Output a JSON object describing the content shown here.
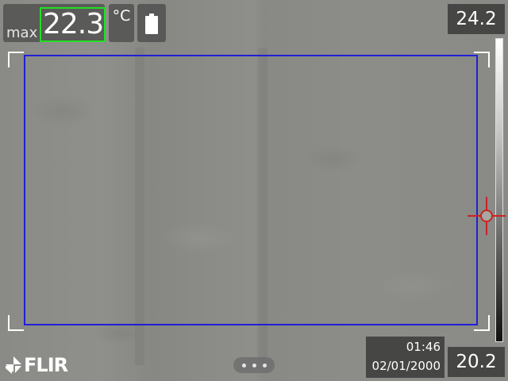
{
  "measurement": {
    "label": "max",
    "value": "22.3"
  },
  "unit": "°C",
  "battery": {
    "icon": "battery-icon"
  },
  "scale": {
    "max": "24.2",
    "min": "20.2"
  },
  "datetime": {
    "time": "01:46",
    "date": "02/01/2000"
  },
  "brand": {
    "name": "FLIR"
  },
  "menu": {
    "icon": "more-dots-icon"
  },
  "colors": {
    "area_box": "#1f1fd6",
    "highlight": "#22e022",
    "spot": "#cc2222"
  }
}
